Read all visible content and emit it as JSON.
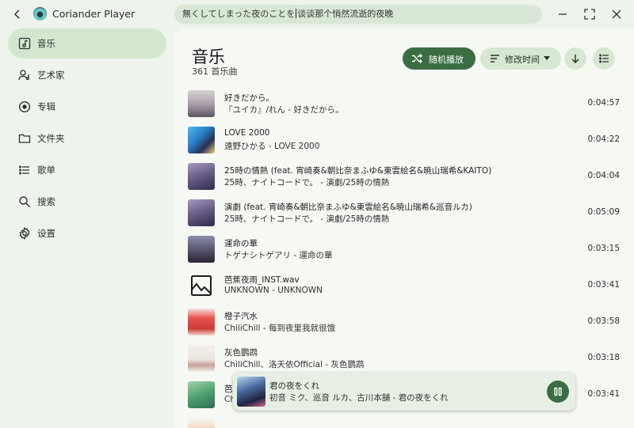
{
  "app": {
    "title": "Coriander Player"
  },
  "lyric": {
    "left": "無くしてしまった夜のことを",
    "right": "谈谈那个悄然流逝的夜晚"
  },
  "sidebar": {
    "items": [
      {
        "label": "音乐",
        "icon": "music-note-icon",
        "active": true
      },
      {
        "label": "艺术家",
        "icon": "artist-icon",
        "active": false
      },
      {
        "label": "专辑",
        "icon": "album-icon",
        "active": false
      },
      {
        "label": "文件夹",
        "icon": "folder-icon",
        "active": false
      },
      {
        "label": "歌单",
        "icon": "playlist-icon",
        "active": false
      },
      {
        "label": "搜索",
        "icon": "search-icon",
        "active": false
      },
      {
        "label": "设置",
        "icon": "gear-icon",
        "active": false
      }
    ]
  },
  "header": {
    "title": "音乐",
    "count": "361 首乐曲",
    "shuffle_label": "随机播放",
    "sort_label": "修改时间"
  },
  "songs": [
    {
      "title": "好きだから。",
      "subtitle": "『ユイカ』/れん - 好きだから。",
      "duration": "0:04:57",
      "cover": [
        "#c9c4c8",
        "#7a7480"
      ]
    },
    {
      "title": "LOVE 2000",
      "subtitle": "遠野ひかる - LOVE 2000",
      "duration": "0:04:22",
      "cover": [
        "#38a6de",
        "#2b2f58"
      ]
    },
    {
      "title": "25時の情熱 (feat. 宵崎奏&朝比奈まふゆ&東雲絵名&暁山瑞希&KAITO)",
      "subtitle": "25時、ナイトコードで。 - 演劇/25時の情熱",
      "duration": "0:04:04",
      "cover": [
        "#8e7aa8",
        "#3a3456"
      ]
    },
    {
      "title": "演劇 (feat. 宵崎奏&朝比奈まふゆ&東雲絵名&暁山瑞希&巡音ルカ)",
      "subtitle": "25時、ナイトコードで。 - 演劇/25時の情熱",
      "duration": "0:05:09",
      "cover": [
        "#8e7aa8",
        "#3a3456"
      ]
    },
    {
      "title": "運命の華",
      "subtitle": "トゲナシトゲアリ - 運命の華",
      "duration": "0:03:15",
      "cover": [
        "#6a6f88",
        "#2e2838"
      ]
    },
    {
      "title": "芭蕉夜雨_INST.wav",
      "subtitle": "UNKNOWN - UNKNOWN",
      "duration": "0:03:41",
      "cover": [
        "placeholder",
        "placeholder"
      ]
    },
    {
      "title": "橙子汽水",
      "subtitle": "ChiliChill - 每到夜里我就很饿",
      "duration": "0:03:58",
      "cover": [
        "#e25a55",
        "#f3d9d3"
      ]
    },
    {
      "title": "灰色鹦鹉",
      "subtitle": "ChiliChill、洛天依Official - 灰色鹦鹉",
      "duration": "0:03:18",
      "cover": [
        "#f2efea",
        "#c8a8a0"
      ]
    },
    {
      "title": "芭",
      "subtitle": "Ch",
      "duration": "0:03:41",
      "cover": [
        "#5dae7a",
        "#2f6b52"
      ]
    }
  ],
  "now_playing": {
    "title": "君の夜をくれ",
    "subtitle": "初音 ミク、巡音 ルカ、古川本舗 - 君の夜をくれ"
  },
  "colors": {
    "accent": "#3a6e42",
    "active_nav": "#d3e7cf",
    "chip": "#d6e7d2"
  }
}
